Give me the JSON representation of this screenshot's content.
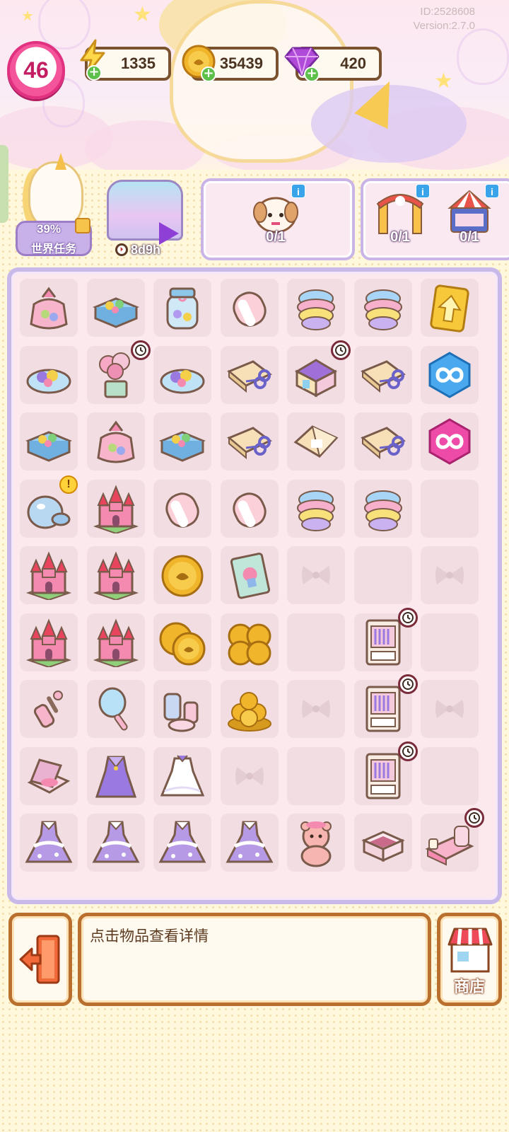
{
  "header": {
    "player_id": "ID:2528608",
    "version": "Version:2.7.0",
    "level": "46",
    "energy": "1335",
    "coins": "35439",
    "gems": "420"
  },
  "world_task": {
    "percent": "39%",
    "label": "世界任务"
  },
  "event": {
    "timer": "8d9h"
  },
  "orders": [
    {
      "name": "puppy-order",
      "count": "0/1"
    },
    {
      "name": "gate-order",
      "count": "0/1"
    },
    {
      "name": "carousel-order",
      "count": "0/1"
    }
  ],
  "board": {
    "rows": [
      [
        "candy-bag",
        "candy-box",
        "candy-jar",
        "marshmallow",
        "cotton-candy",
        "cotton-candy",
        "arrow-card"
      ],
      [
        "candy-plate",
        "balloon-gift",
        "candy-plate",
        "paper-scissors",
        "toy-shop",
        "paper-scissors",
        "blue-infinity"
      ],
      [
        "candy-box",
        "candy-bag",
        "candy-box",
        "paper-scissors",
        "paper-box",
        "paper-scissors",
        "pink-infinity"
      ],
      [
        "glass-jar",
        "castle",
        "marshmallow",
        "marshmallow",
        "cotton-candy",
        "cotton-candy",
        "empty"
      ],
      [
        "castle",
        "castle",
        "coin",
        "storybook",
        "locked",
        "empty",
        "locked"
      ],
      [
        "castle",
        "castle",
        "coin-pair",
        "coin-stack",
        "empty",
        "wardrobe",
        "empty"
      ],
      [
        "lint-roller",
        "hand-mirror",
        "cosmetics",
        "coin-pile",
        "locked",
        "wardrobe",
        "locked"
      ],
      [
        "compact",
        "purple-dress",
        "white-dress",
        "locked",
        "empty",
        "wardrobe",
        "empty"
      ],
      [
        "ball-gown",
        "ball-gown",
        "ball-gown",
        "ball-gown",
        "teddy-bear",
        "drawer",
        "princess-bed"
      ]
    ],
    "timers": [
      "1-1",
      "1-4",
      "5-5",
      "6-5",
      "7-5",
      "8-6"
    ],
    "alerts": [
      "3-0"
    ]
  },
  "bottom": {
    "hint": "点击物品查看详情",
    "shop_label": "商店"
  },
  "colors": {
    "border_brown": "#b9702e",
    "board_purple": "#c9b9e8",
    "level_pink": "#f4559a",
    "energy_yellow": "#ffd84a",
    "coin_gold": "#f0b52a",
    "gem_purple": "#b04ad8"
  }
}
